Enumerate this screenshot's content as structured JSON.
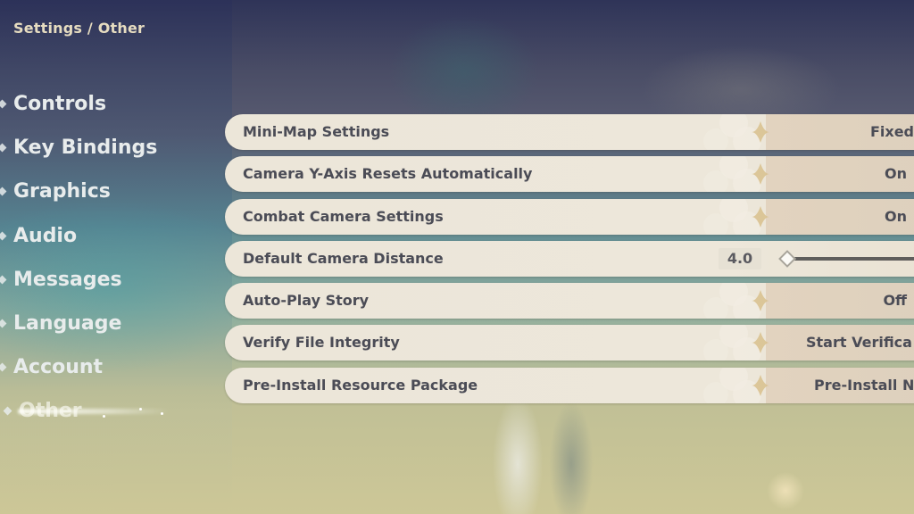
{
  "breadcrumb": "Settings / Other",
  "nav": {
    "items": [
      {
        "label": "Controls",
        "active": false
      },
      {
        "label": "Key Bindings",
        "active": false
      },
      {
        "label": "Graphics",
        "active": false
      },
      {
        "label": "Audio",
        "active": false
      },
      {
        "label": "Messages",
        "active": false
      },
      {
        "label": "Language",
        "active": false
      },
      {
        "label": "Account",
        "active": false
      },
      {
        "label": "Other",
        "active": true
      }
    ]
  },
  "settings": [
    {
      "label": "Mini-Map Settings",
      "value": "Fixed",
      "type": "select"
    },
    {
      "label": "Camera Y-Axis Resets Automatically",
      "value": "On",
      "type": "select"
    },
    {
      "label": "Combat Camera Settings",
      "value": "On",
      "type": "select"
    },
    {
      "label": "Default Camera Distance",
      "value": "4.0",
      "type": "slider",
      "slider_fraction": 0.0
    },
    {
      "label": "Auto-Play Story",
      "value": "Off",
      "type": "select"
    },
    {
      "label": "Verify File Integrity",
      "value": "Start Verifica",
      "type": "button"
    },
    {
      "label": "Pre-Install Resource Package",
      "value": "Pre-Install N",
      "type": "button"
    }
  ],
  "colors": {
    "row_bg": "#ece6d9",
    "value_bg": "#e2d3bf",
    "text_dark": "#4b4c56",
    "accent_gold": "#d8bf8c"
  }
}
